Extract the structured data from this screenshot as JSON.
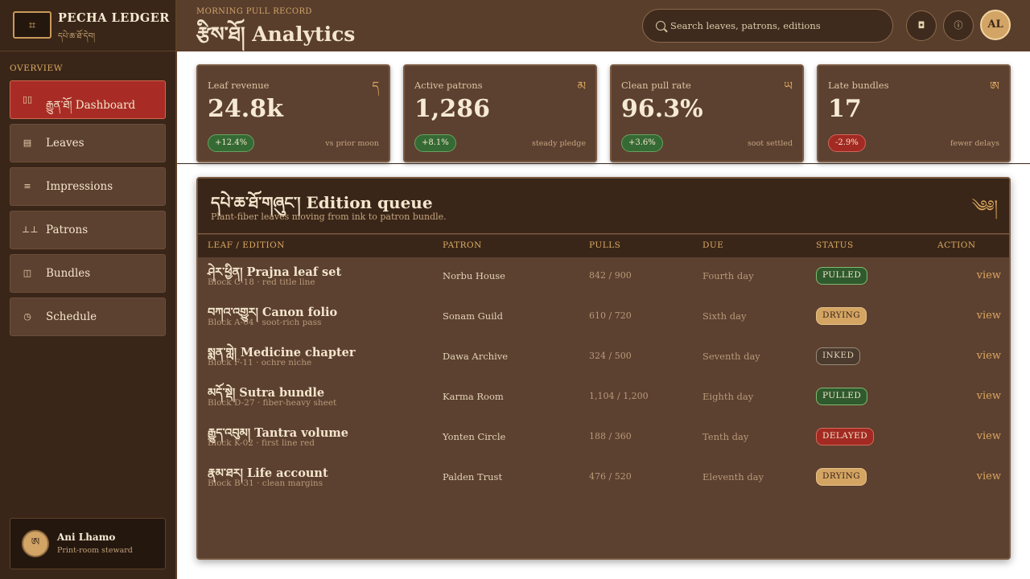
{
  "sidebar": {
    "brand": {
      "mark": "⌗",
      "title": "PECHA LEDGER",
      "subtitle": "དཔེ་ཆ་ཐོ་དེབ།"
    },
    "section_label": "OVERVIEW",
    "items": [
      {
        "icon": "▯▯",
        "label": "རྒྱུན་ཐོ། Dashboard",
        "active": true
      },
      {
        "icon": "▤",
        "label": "Leaves",
        "active": false
      },
      {
        "icon": "≡",
        "label": "Impressions",
        "active": false
      },
      {
        "icon": "⊥⊥",
        "label": "Patrons",
        "active": false
      },
      {
        "icon": "◫",
        "label": "Bundles",
        "active": false
      },
      {
        "icon": "◷",
        "label": "Schedule",
        "active": false
      }
    ],
    "user": {
      "avatar": "ཨ",
      "name": "Ani Lhamo",
      "role": "Print-room steward"
    }
  },
  "header": {
    "eyebrow": "MORNING PULL RECORD",
    "title": "རྩིས་ཐོ། Analytics",
    "search_placeholder": "Search leaves, patrons, editions",
    "bell_icon": "◘",
    "info_icon": "ⓘ",
    "avatar": "AL"
  },
  "metrics": [
    {
      "label": "Leaf revenue",
      "glyph": "ད",
      "value": "24.8k",
      "delta": "+12.4%",
      "trend": "up",
      "note": "vs prior moon"
    },
    {
      "label": "Active patrons",
      "glyph": "མ",
      "value": "1,286",
      "delta": "+8.1%",
      "trend": "up",
      "note": "steady pledge"
    },
    {
      "label": "Clean pull rate",
      "glyph": "ཡ",
      "value": "96.3%",
      "delta": "+3.6%",
      "trend": "up",
      "note": "soot settled"
    },
    {
      "label": "Late bundles",
      "glyph": "ཨ",
      "value": "17",
      "delta": "-2.9%",
      "trend": "down",
      "note": "fewer delays"
    }
  ],
  "queue": {
    "title": "དཔེ་ཆ་ཐོ་གཞུང་། Edition queue",
    "subtitle": "Plant-fiber leaves moving from ink to patron bundle.",
    "glyph": "༄༅།",
    "columns": [
      "LEAF / EDITION",
      "PATRON",
      "PULLS",
      "DUE",
      "STATUS",
      "ACTION"
    ],
    "rows": [
      {
        "title": "ཤེར་ཕྱིན། Prajna leaf set",
        "sub": "Block C-18 · red title line",
        "patron": "Norbu House",
        "pulls": "842 / 900",
        "due": "Fourth day",
        "status": "PULLED",
        "status_kind": "pulled",
        "action": "view"
      },
      {
        "title": "བཀའ་འགྱུར། Canon folio",
        "sub": "Block A-04 · soot-rich pass",
        "patron": "Sonam Guild",
        "pulls": "610 / 720",
        "due": "Sixth day",
        "status": "DRYING",
        "status_kind": "drying",
        "action": "view"
      },
      {
        "title": "སྨན་གླེ། Medicine chapter",
        "sub": "Block F-11 · ochre niche",
        "patron": "Dawa Archive",
        "pulls": "324 / 500",
        "due": "Seventh day",
        "status": "INKED",
        "status_kind": "inked",
        "action": "view"
      },
      {
        "title": "མདོ་སྡེ། Sutra bundle",
        "sub": "Block D-27 · fiber-heavy sheet",
        "patron": "Karma Room",
        "pulls": "1,104 / 1,200",
        "due": "Eighth day",
        "status": "PULLED",
        "status_kind": "pulled",
        "action": "view"
      },
      {
        "title": "རྒྱུད་འབུམ། Tantra volume",
        "sub": "Block K-02 · first line red",
        "patron": "Yonten Circle",
        "pulls": "188 / 360",
        "due": "Tenth day",
        "status": "DELAYED",
        "status_kind": "delayed",
        "action": "view"
      },
      {
        "title": "རྣམ་ཐར། Life account",
        "sub": "Block B-31 · clean margins",
        "patron": "Palden Trust",
        "pulls": "476 / 520",
        "due": "Eleventh day",
        "status": "DRYING",
        "status_kind": "drying",
        "action": "view"
      }
    ]
  }
}
